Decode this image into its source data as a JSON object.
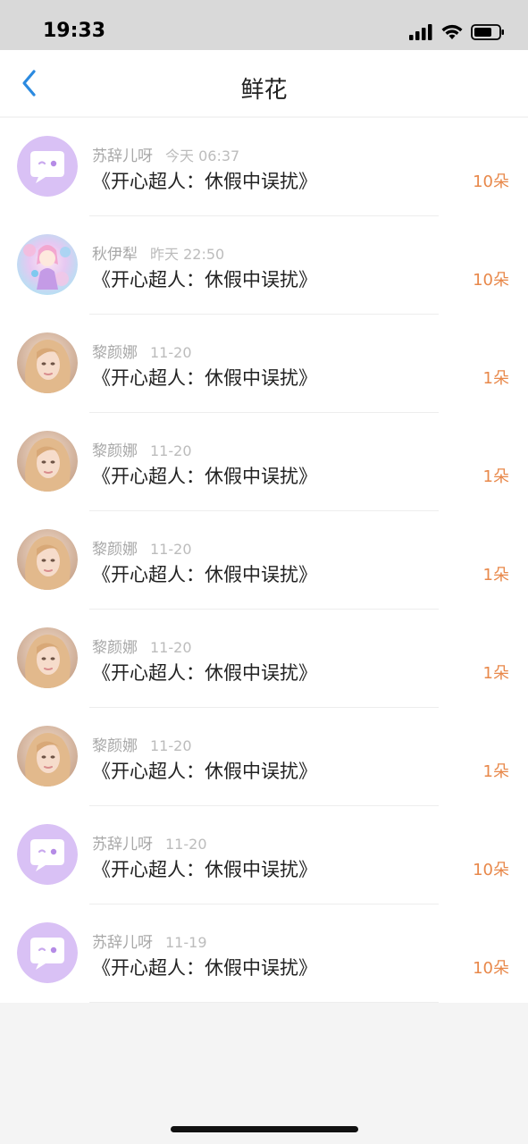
{
  "status_bar": {
    "time": "19:33"
  },
  "nav": {
    "title": "鲜花",
    "back_icon": "chevron-left-icon"
  },
  "colors": {
    "accent_back": "#2b8ae0",
    "count": "#e8884a",
    "chat_avatar_bg": "#d9c1f5"
  },
  "flowers": [
    {
      "name": "苏辞儿呀",
      "time": "今天 06:37",
      "work": "《开心超人：休假中误扰》",
      "count": "10朵",
      "avatar": "chat-bubble-avatar"
    },
    {
      "name": "秋伊犁",
      "time": "昨天 22:50",
      "work": "《开心超人：休假中误扰》",
      "count": "10朵",
      "avatar": "anime-girl-avatar"
    },
    {
      "name": "黎颜娜",
      "time": "11-20",
      "work": "《开心超人：休假中误扰》",
      "count": "1朵",
      "avatar": "portrait-avatar"
    },
    {
      "name": "黎颜娜",
      "time": "11-20",
      "work": "《开心超人：休假中误扰》",
      "count": "1朵",
      "avatar": "portrait-avatar"
    },
    {
      "name": "黎颜娜",
      "time": "11-20",
      "work": "《开心超人：休假中误扰》",
      "count": "1朵",
      "avatar": "portrait-avatar"
    },
    {
      "name": "黎颜娜",
      "time": "11-20",
      "work": "《开心超人：休假中误扰》",
      "count": "1朵",
      "avatar": "portrait-avatar"
    },
    {
      "name": "黎颜娜",
      "time": "11-20",
      "work": "《开心超人：休假中误扰》",
      "count": "1朵",
      "avatar": "portrait-avatar"
    },
    {
      "name": "苏辞儿呀",
      "time": "11-20",
      "work": "《开心超人：休假中误扰》",
      "count": "10朵",
      "avatar": "chat-bubble-avatar"
    },
    {
      "name": "苏辞儿呀",
      "time": "11-19",
      "work": "《开心超人：休假中误扰》",
      "count": "10朵",
      "avatar": "chat-bubble-avatar"
    }
  ]
}
